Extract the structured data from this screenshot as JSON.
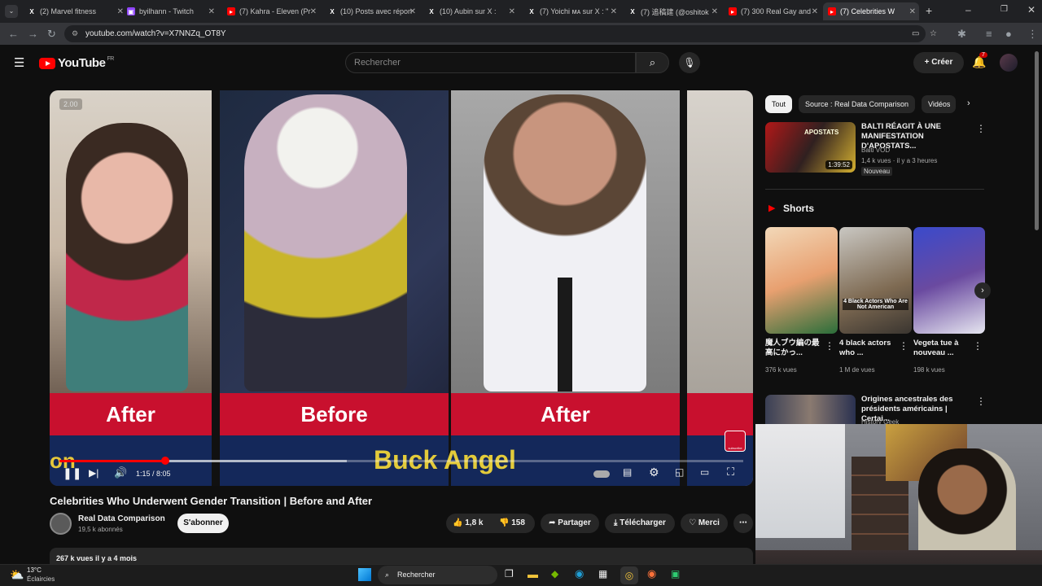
{
  "browser": {
    "tabs": [
      {
        "label": "(2) Marvel fitness",
        "icon": "x-logo-icon"
      },
      {
        "label": "byilhann - Twitch",
        "icon": "twitch-icon"
      },
      {
        "label": "(7) Kahra - Eleven (Pr",
        "icon": "youtube-icon"
      },
      {
        "label": "(10) Posts avec répon",
        "icon": "x-logo-icon"
      },
      {
        "label": "(10) Aubin sur X :",
        "icon": "x-logo-icon"
      },
      {
        "label": "(7) Yoichi ᴍᴀ sur X : \"",
        "icon": "x-logo-icon"
      },
      {
        "label": "(7) 追稿建 (@oshitok",
        "icon": "x-logo-icon"
      },
      {
        "label": "(7) 300 Real Gay and",
        "icon": "youtube-icon"
      },
      {
        "label": "(7) Celebrities W",
        "icon": "youtube-icon",
        "active": true
      }
    ],
    "url": "youtube.com/watch?v=X7NNZq_OT8Y"
  },
  "youtube": {
    "logo_text": "YouTube",
    "region": "FR",
    "search_placeholder": "Rechercher",
    "create_label": "Créer",
    "notification_count": "7"
  },
  "video": {
    "panels": [
      {
        "label": "After",
        "name": ""
      },
      {
        "label": "Before",
        "name": "Buck Angel"
      },
      {
        "label": "After",
        "name": ""
      }
    ],
    "partial_text": "on",
    "speed_badge": "2.00",
    "time": "1:15 / 8:05",
    "progress": 0.155,
    "buffered": 0.42,
    "subscribe_watermark": "subscribe"
  },
  "info": {
    "title": "Celebrities Who Underwent Gender Transition | Before and After",
    "channel": "Real Data Comparison",
    "subscribers": "19,5 k abonnés",
    "subscribe_label": "S'abonner",
    "likes": "1,8 k",
    "dislikes": "158",
    "share": "Partager",
    "download": "Télécharger",
    "thanks": "Merci",
    "views": "267 k vues  il y a 4 mois"
  },
  "sidebar": {
    "chips": [
      "Tout",
      "Source : Real Data Comparison",
      "Vidéos"
    ],
    "first_video": {
      "title": "BALTI RÉAGIT À UNE MANIFESTATION D'APOSTATS...",
      "channel": "Balti VOD",
      "meta": "1,4 k vues · il y a 3 heures",
      "badge": "Nouveau",
      "duration": "1:39:52",
      "thumb_text": "APOSTATS"
    },
    "shorts_title": "Shorts",
    "shorts": [
      {
        "title": "魔人ブウ編の最高にかっ...",
        "views": "376 k vues",
        "thumb_text": ""
      },
      {
        "title": "4 black actors who ...",
        "views": "1 M de vues",
        "thumb_text": "4 Black Actors Who Are Not American"
      },
      {
        "title": "Vegeta tue à nouveau ...",
        "views": "198 k vues",
        "thumb_text": ""
      }
    ],
    "second_video": {
      "title": "Origines ancestrales des présidents américains | Certai...",
      "channel": "History Geek"
    }
  },
  "taskbar": {
    "temperature": "13°C",
    "weather": "Éclaircies",
    "search": "Rechercher"
  }
}
